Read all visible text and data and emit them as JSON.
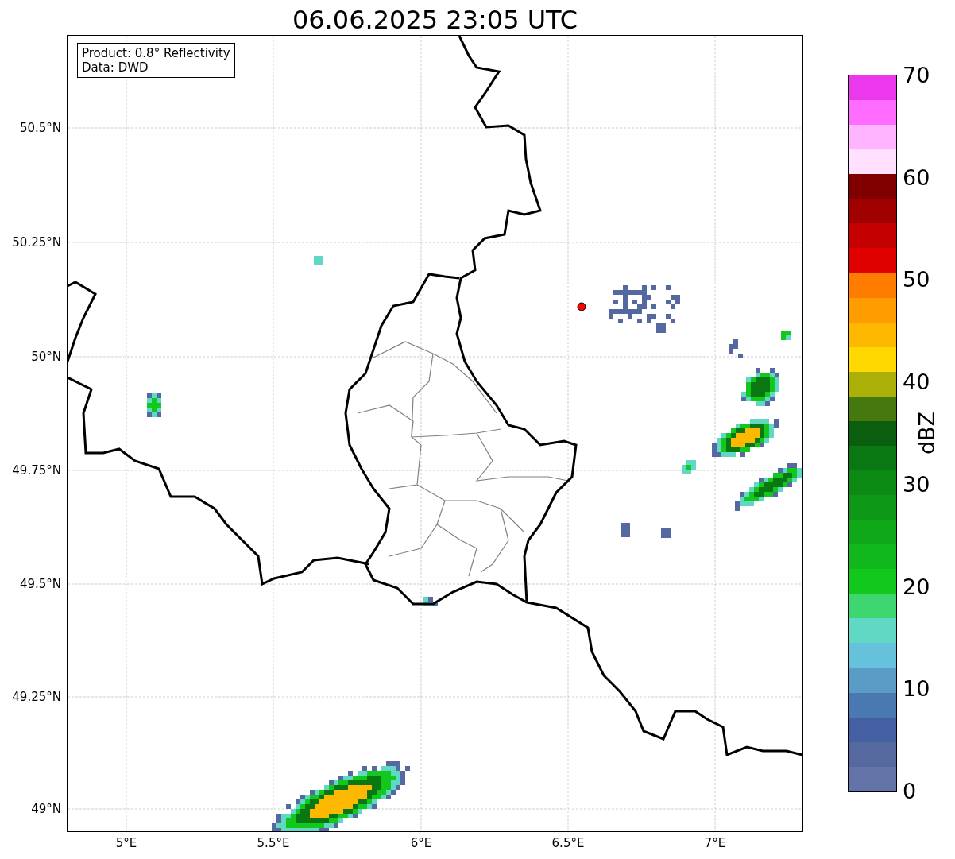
{
  "title": "06.06.2025 23:05 UTC",
  "legend": [
    "Product: 0.8° Reflectivity",
    "Data: DWD"
  ],
  "x_ticks": [
    "5°E",
    "5.5°E",
    "6°E",
    "6.5°E",
    "7°E"
  ],
  "y_ticks": [
    "50.5°N",
    "50.25°N",
    "50°N",
    "49.75°N",
    "49.5°N",
    "49.25°N",
    "49°N"
  ],
  "colorbar": {
    "label": "dBZ",
    "ticks": [
      "70",
      "60",
      "50",
      "40",
      "30",
      "20",
      "10",
      "0"
    ],
    "segments": [
      {
        "color": "#ec38ec"
      },
      {
        "color": "#ff6cff"
      },
      {
        "color": "#ffb4ff"
      },
      {
        "color": "#ffe0ff"
      },
      {
        "color": "#800000"
      },
      {
        "color": "#a00000"
      },
      {
        "color": "#c40000"
      },
      {
        "color": "#e00000"
      },
      {
        "color": "#ff7c00"
      },
      {
        "color": "#ff9c00"
      },
      {
        "color": "#ffb800"
      },
      {
        "color": "#ffd800"
      },
      {
        "color": "#aab008"
      },
      {
        "color": "#467810"
      },
      {
        "color": "#0a5e0e"
      },
      {
        "color": "#0a7812"
      },
      {
        "color": "#0c8a14"
      },
      {
        "color": "#0e9818"
      },
      {
        "color": "#10a818"
      },
      {
        "color": "#10b81c"
      },
      {
        "color": "#12c81c"
      },
      {
        "color": "#3ed670"
      },
      {
        "color": "#60d8c4"
      },
      {
        "color": "#66c2dc"
      },
      {
        "color": "#5a9cc6"
      },
      {
        "color": "#4a78b0"
      },
      {
        "color": "#4560a2"
      },
      {
        "color": "#5568a0"
      },
      {
        "color": "#6474a8"
      }
    ]
  }
}
